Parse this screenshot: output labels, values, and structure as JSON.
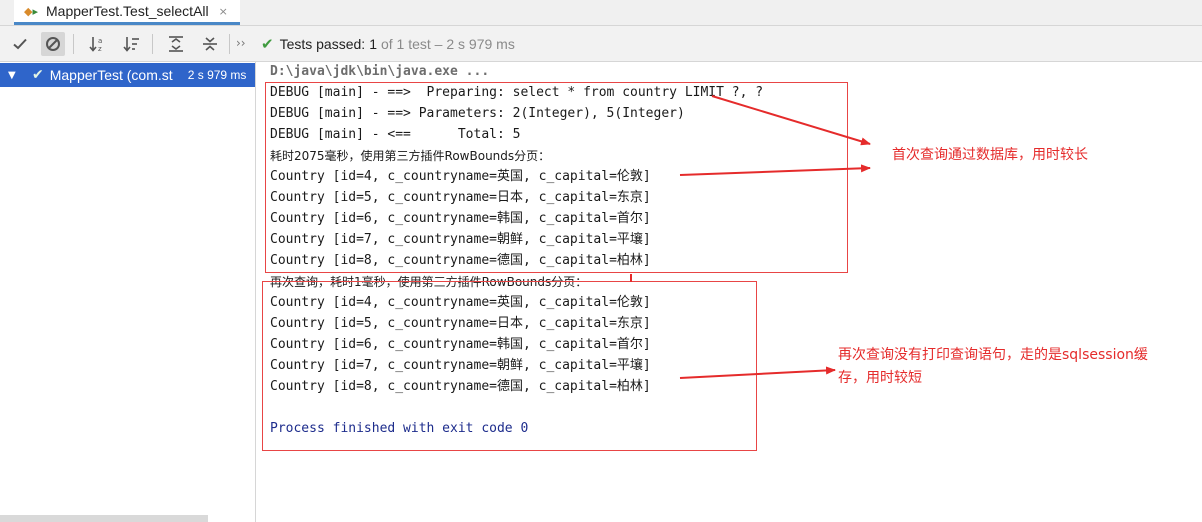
{
  "tab": {
    "title": "MapperTest.Test_selectAll",
    "close": "×"
  },
  "toolbar": {
    "more": "››",
    "status_label": "Tests passed:",
    "status_count": "1",
    "status_rest": "of 1 test – 2 s 979 ms"
  },
  "tree": {
    "items": [
      {
        "name": "MapperTest (com.st",
        "time": "2 s 979 ms",
        "passed": true
      }
    ]
  },
  "console": {
    "lines": [
      "D:\\java\\jdk\\bin\\java.exe ...",
      "DEBUG [main] - ==>  Preparing: select * from country LIMIT ?, ?",
      "DEBUG [main] - ==> Parameters: 2(Integer), 5(Integer)",
      "DEBUG [main] - <==      Total: 5",
      "耗时2075毫秒，使用第三方插件RowBounds分页：",
      "Country [id=4, c_countryname=英国, c_capital=伦敦]",
      "Country [id=5, c_countryname=日本, c_capital=东京]",
      "Country [id=6, c_countryname=韩国, c_capital=首尔]",
      "Country [id=7, c_countryname=朝鲜, c_capital=平壤]",
      "Country [id=8, c_countryname=德国, c_capital=柏林]",
      "再次查询，耗时1毫秒，使用第三方插件RowBounds分页：",
      "Country [id=4, c_countryname=英国, c_capital=伦敦]",
      "Country [id=5, c_countryname=日本, c_capital=东京]",
      "Country [id=6, c_countryname=韩国, c_capital=首尔]",
      "Country [id=7, c_countryname=朝鲜, c_capital=平壤]",
      "Country [id=8, c_countryname=德国, c_capital=柏林]",
      "",
      "Process finished with exit code 0"
    ]
  },
  "annotations": {
    "first_query": "首次查询通过数据库，用时较长",
    "second_query_line1": "再次查询没有打印查询语句，走的是sqlsession缓",
    "second_query_line2": "存，用时较短"
  },
  "colors": {
    "annotation": "#e52b2b",
    "selection": "#2f65ca",
    "pass_green": "#3f9b3f",
    "exit_text": "#1d2c8c"
  }
}
